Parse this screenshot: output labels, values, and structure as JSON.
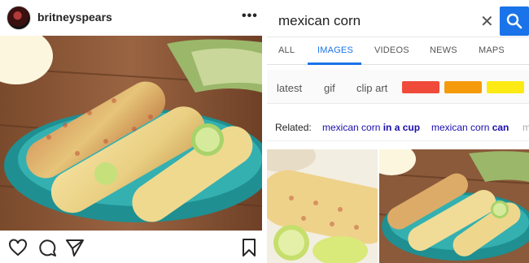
{
  "instagram": {
    "username": "britneyspears",
    "more_icon": "more-dots-icon",
    "actions": [
      "heart-icon",
      "comment-icon",
      "share-icon",
      "bookmark-icon"
    ]
  },
  "search": {
    "query": "mexican corn",
    "clear_icon": "close-icon",
    "search_icon": "search-icon",
    "tabs": [
      {
        "label": "ALL",
        "active": false
      },
      {
        "label": "IMAGES",
        "active": true
      },
      {
        "label": "VIDEOS",
        "active": false
      },
      {
        "label": "NEWS",
        "active": false
      },
      {
        "label": "MAPS",
        "active": false
      }
    ],
    "filters": {
      "chips": [
        "latest",
        "gif",
        "clip art"
      ],
      "color_swatches": [
        "#f04b3a",
        "#f59b0b",
        "#fdea14"
      ]
    },
    "related": {
      "label": "Related:",
      "items": [
        {
          "prefix": "mexican corn ",
          "bold": "in a cup"
        },
        {
          "prefix": "mexican corn ",
          "bold": "can"
        },
        {
          "prefix": "m",
          "bold": ""
        }
      ]
    }
  },
  "colors": {
    "accent": "#1a73e8",
    "link": "#1a0dab",
    "plate": "#2aa3a3",
    "table_wood": "#8a5a3a"
  }
}
